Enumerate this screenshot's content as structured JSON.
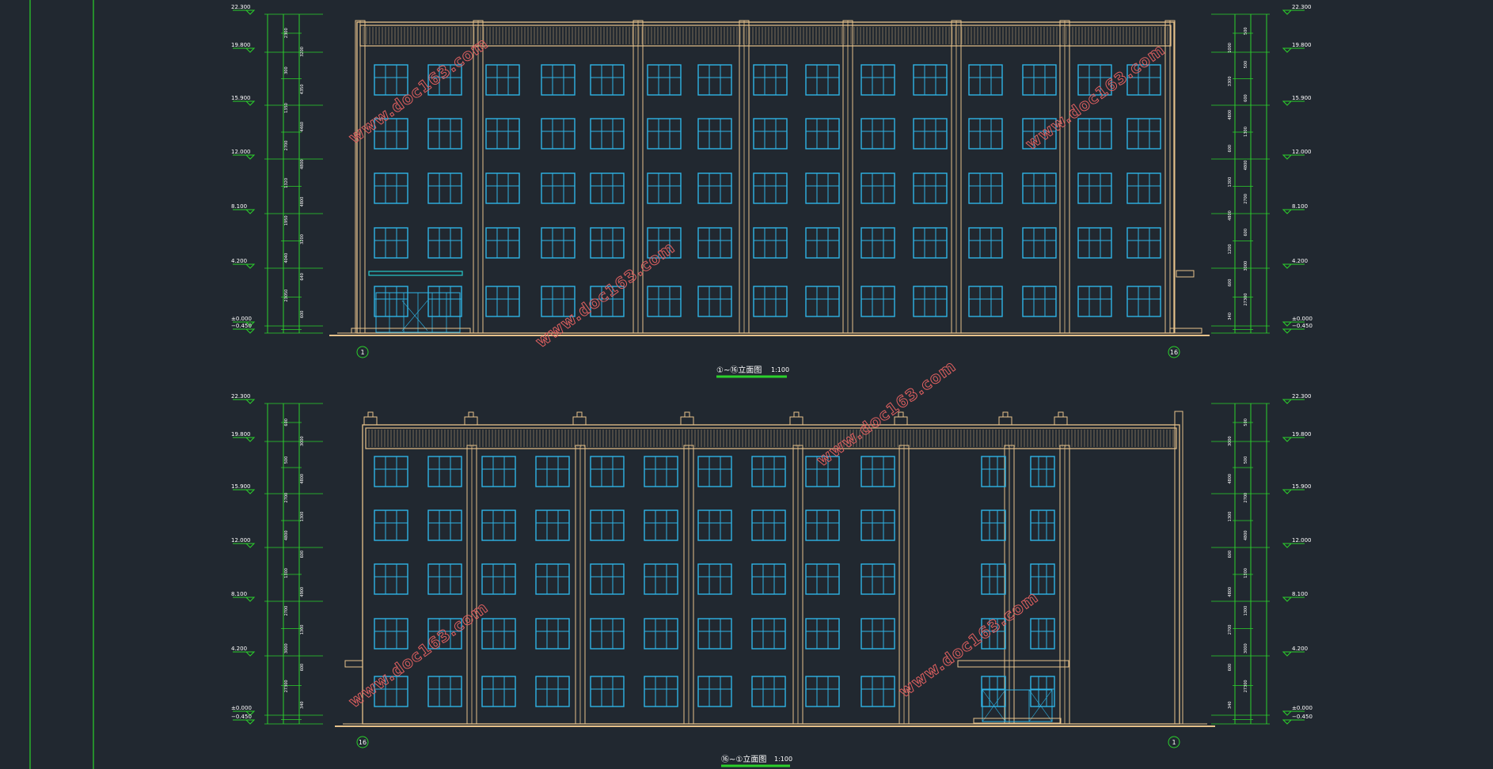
{
  "colors": {
    "background": "#212830",
    "frame": "#2bd22b",
    "wall": "#e7c28b",
    "window": "#2fb4e6",
    "dimension": "#2bd22b",
    "text": "#ffffff",
    "watermark": "#e06060",
    "canopy": "#d8c84a"
  },
  "drawing_1": {
    "title": "①~⑯立面图",
    "scale": "1:100",
    "axis_start": "1",
    "axis_end": "16",
    "left_levels": [
      "22.300",
      "19.800",
      "15.900",
      "12.000",
      "8.100",
      "4.200",
      "±0.000",
      "−0.450"
    ],
    "right_levels": [
      "22.300",
      "19.800",
      "15.900",
      "12.000",
      "8.100",
      "4.200",
      "±0.000",
      "−0.450"
    ],
    "left_dims": [
      "2300",
      "3200",
      "300",
      "4350",
      "1350",
      "4460",
      "2700",
      "4800",
      "1320",
      "4800",
      "1950",
      "3200",
      "4040",
      "640",
      "23050",
      "600"
    ],
    "right_dims": [
      "500",
      "1000",
      "500",
      "3300",
      "600",
      "4800",
      "1300",
      "600",
      "4800",
      "1300",
      "2700",
      "4800",
      "600",
      "1200",
      "3000",
      "600",
      "27300",
      "340"
    ]
  },
  "drawing_2": {
    "title": "⑯~①立面图",
    "scale": "1:100",
    "axis_start": "16",
    "axis_end": "1",
    "left_levels": [
      "22.300",
      "19.800",
      "15.900",
      "12.000",
      "8.100",
      "4.200",
      "±0.000",
      "−0.450"
    ],
    "right_levels": [
      "22.300",
      "19.800",
      "15.900",
      "12.000",
      "8.100",
      "4.200",
      "±0.000",
      "−0.450"
    ],
    "left_dims": [
      "600",
      "3000",
      "500",
      "4800",
      "2700",
      "1300",
      "4800",
      "600",
      "1300",
      "4900",
      "2700",
      "1300",
      "3000",
      "600",
      "27300",
      "340"
    ],
    "right_dims": [
      "500",
      "3000",
      "500",
      "4800",
      "2700",
      "1300",
      "4800",
      "600",
      "1300",
      "4800",
      "1300",
      "2700",
      "3000",
      "600",
      "27300",
      "340"
    ]
  },
  "watermarks": [
    "www.doc163.com",
    "www.doc163.com",
    "www.doc163.com",
    "www.doc163.com",
    "www.doc163.com",
    "www.doc163.com"
  ]
}
